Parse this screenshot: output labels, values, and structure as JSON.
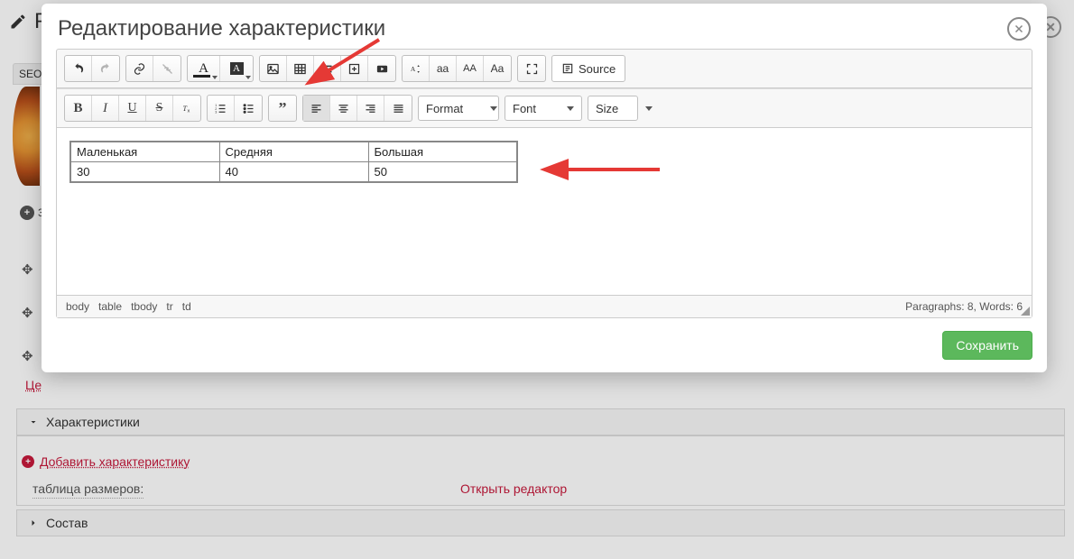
{
  "bg": {
    "header_letter": "Р",
    "seo_tab": "SEO",
    "plus_label": "3",
    "price_link": "Це",
    "panel_characteristics": "Характеристики",
    "add_characteristic": "Добавить характеристику",
    "size_table_label": "таблица размеров:",
    "open_editor": "Открыть редактор",
    "panel_sostav": "Состав"
  },
  "modal": {
    "title": "Редактирование характеристики",
    "source_label": "Source",
    "combo_format": "Format",
    "combo_font": "Font",
    "combo_size": "Size",
    "path": [
      "body",
      "table",
      "tbody",
      "tr",
      "td"
    ],
    "status": "Paragraphs: 8, Words: 6",
    "save": "Сохранить",
    "table": {
      "r0c0": "Маленькая",
      "r0c1": "Средняя",
      "r0c2": "Большая",
      "r1c0": "30",
      "r1c1": "40",
      "r1c2": "50"
    }
  },
  "chart_data": {
    "type": "table",
    "columns": [
      "Маленькая",
      "Средняя",
      "Большая"
    ],
    "rows": [
      [
        30,
        40,
        50
      ]
    ],
    "title": "таблица размеров"
  }
}
